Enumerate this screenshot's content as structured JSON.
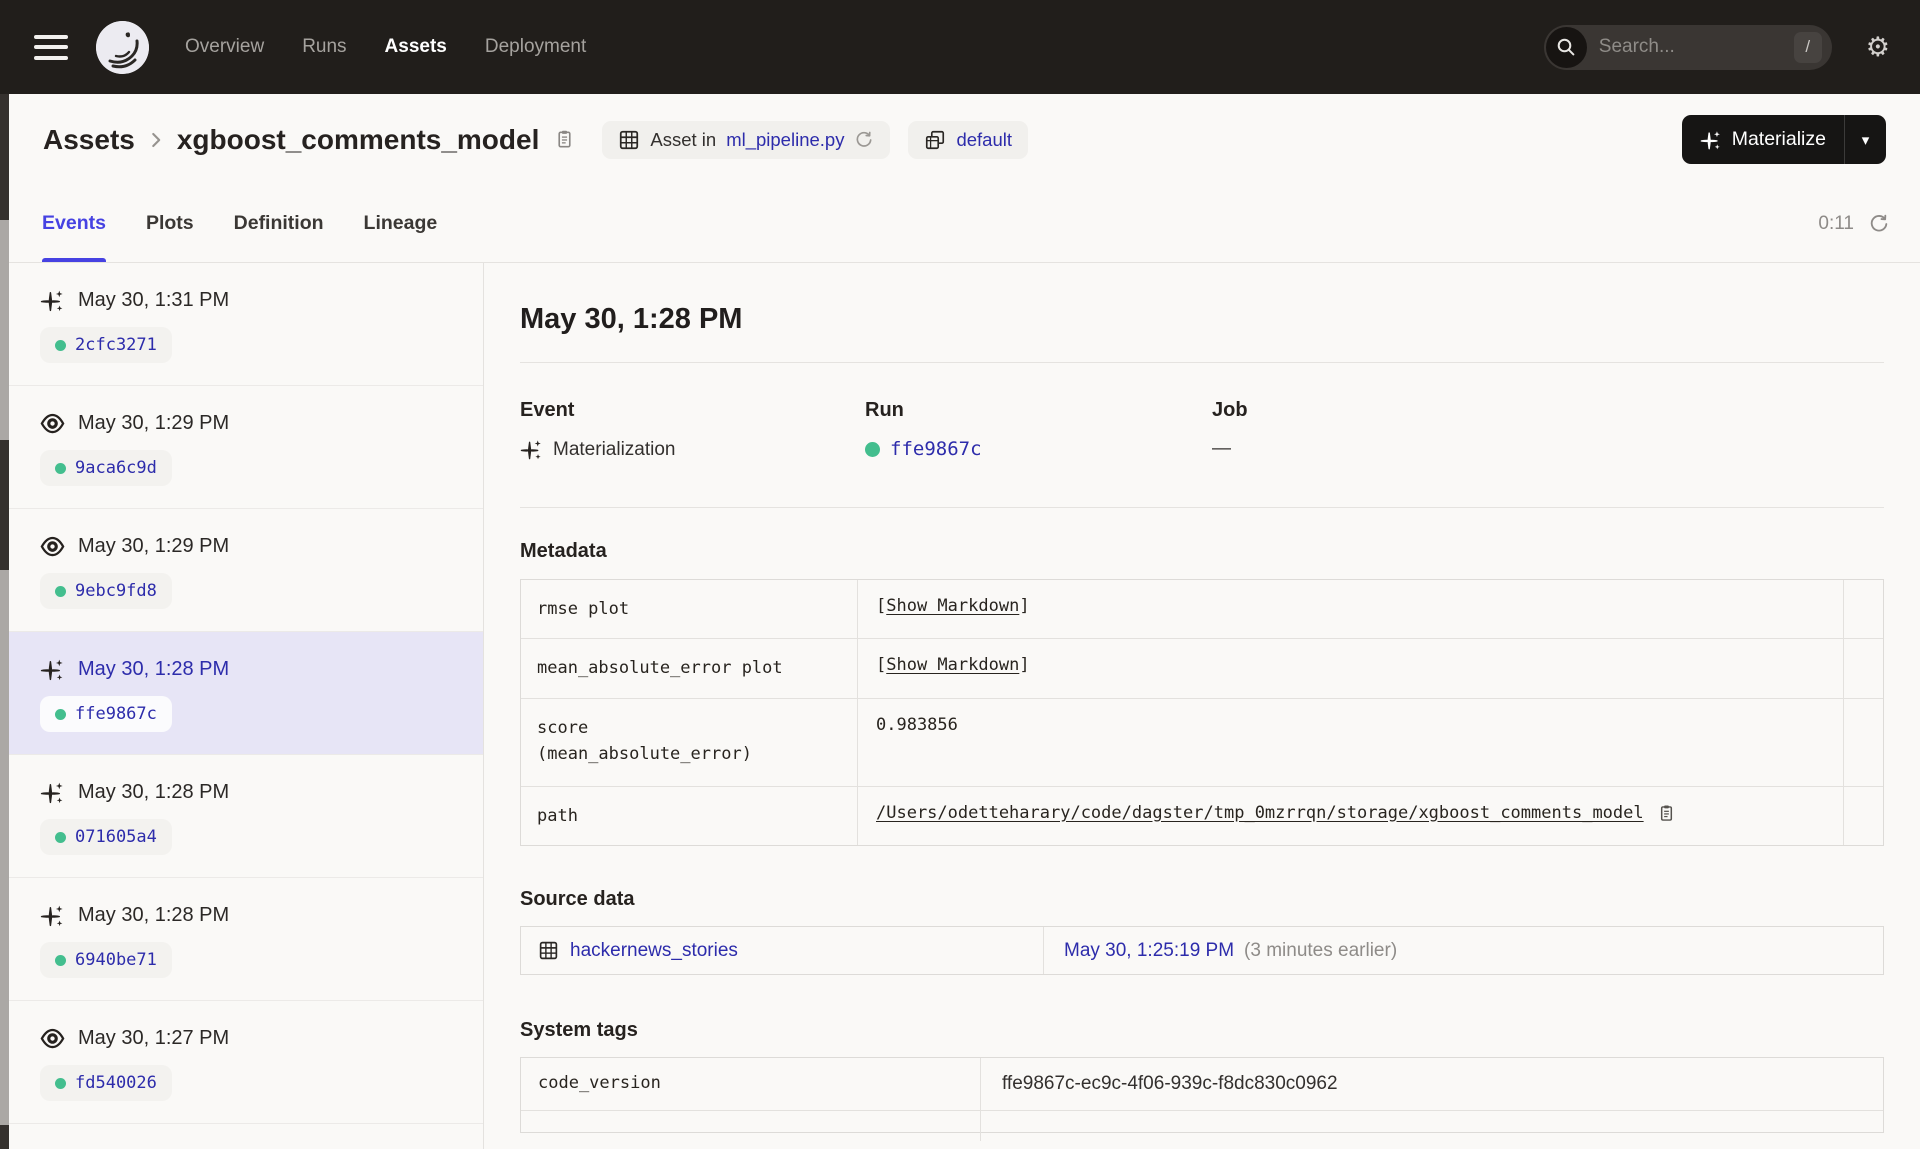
{
  "colors": {
    "nav_bg": "#211E1B",
    "page_bg": "#FAF9F7",
    "accent_blue": "#4642E2",
    "link": "#2D2CAB",
    "green_dot": "#43BE8E",
    "selected_row_bg": "#E7E5F6",
    "materialize_button_bg": "#161514"
  },
  "nav": {
    "items": [
      {
        "label": "Overview",
        "active": false
      },
      {
        "label": "Runs",
        "active": false
      },
      {
        "label": "Assets",
        "active": true
      },
      {
        "label": "Deployment",
        "active": false
      }
    ],
    "search": {
      "placeholder": "Search...",
      "shortcut": "/"
    }
  },
  "header": {
    "breadcrumb": {
      "root": "Assets",
      "asset": "xgboost_comments_model"
    },
    "asset_location": {
      "prefix": "Asset in ",
      "file": "ml_pipeline.py"
    },
    "group": "default",
    "materialize_label": "Materialize"
  },
  "tabs": {
    "items": [
      {
        "label": "Events",
        "active": true
      },
      {
        "label": "Plots",
        "active": false
      },
      {
        "label": "Definition",
        "active": false
      },
      {
        "label": "Lineage",
        "active": false
      }
    ],
    "timer": "0:11"
  },
  "sidebar": {
    "events": [
      {
        "type": "materialization",
        "time": "May 30, 1:31 PM",
        "run_id": "2cfc3271",
        "selected": false
      },
      {
        "type": "observation",
        "time": "May 30, 1:29 PM",
        "run_id": "9aca6c9d",
        "selected": false
      },
      {
        "type": "observation",
        "time": "May 30, 1:29 PM",
        "run_id": "9ebc9fd8",
        "selected": false
      },
      {
        "type": "materialization",
        "time": "May 30, 1:28 PM",
        "run_id": "ffe9867c",
        "selected": true
      },
      {
        "type": "materialization",
        "time": "May 30, 1:28 PM",
        "run_id": "071605a4",
        "selected": false
      },
      {
        "type": "materialization",
        "time": "May 30, 1:28 PM",
        "run_id": "6940be71",
        "selected": false
      },
      {
        "type": "observation",
        "time": "May 30, 1:27 PM",
        "run_id": "fd540026",
        "selected": false
      }
    ]
  },
  "detail": {
    "title": "May 30, 1:28 PM",
    "columns": {
      "event_label": "Event",
      "event_value": "Materialization",
      "run_label": "Run",
      "run_value": "ffe9867c",
      "job_label": "Job",
      "job_value": "—"
    },
    "metadata": {
      "heading": "Metadata",
      "rows": [
        {
          "key": "rmse plot",
          "value": "[Show Markdown]",
          "kind": "markdown"
        },
        {
          "key": "mean_absolute_error plot",
          "value": "[Show Markdown]",
          "kind": "markdown"
        },
        {
          "key": "score\n(mean_absolute_error)",
          "value": "0.983856",
          "kind": "text"
        },
        {
          "key": "path",
          "value": "/Users/odetteharary/code/dagster/tmp_0mzrrqn/storage/xgboost_comments_model",
          "kind": "path"
        }
      ]
    },
    "source_data": {
      "heading": "Source data",
      "rows": [
        {
          "asset": "hackernews_stories",
          "time": "May 30, 1:25:19 PM",
          "note": "(3 minutes earlier)"
        }
      ]
    },
    "system_tags": {
      "heading": "System tags",
      "rows": [
        {
          "key": "code_version",
          "value": "ffe9867c-ec9c-4f06-939c-f8dc830c0962"
        }
      ]
    }
  }
}
